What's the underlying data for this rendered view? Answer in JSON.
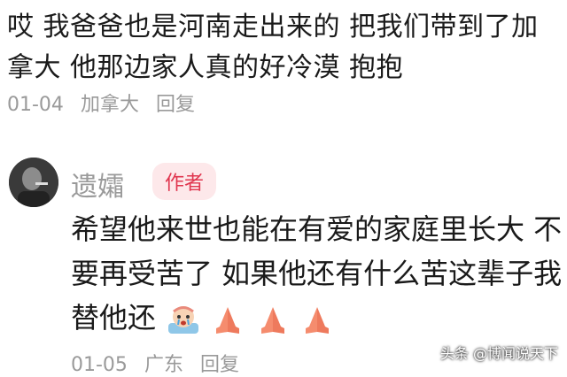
{
  "comment1": {
    "text": "哎 我爸爸也是河南走出来的 把我们带到了加拿大 他那边家人真的好冷漠 抱抱",
    "date": "01-04",
    "location": "加拿大",
    "reply_label": "回复"
  },
  "reply": {
    "username": "遗孀",
    "badge": "作者",
    "text": "希望他来世也能在有爱的家庭里长大 不要再受苦了 如果他还有什么苦这辈子我替他还",
    "emojis": [
      "crying-emoji",
      "pray-hands-icon",
      "pray-hands-icon",
      "pray-hands-icon"
    ],
    "date": "01-05",
    "location": "广东",
    "reply_label": "回复"
  },
  "watermark": {
    "text": "头条 @博闻说天下"
  },
  "colors": {
    "badge_bg": "#fde8ea",
    "badge_text": "#e0364f",
    "meta_text": "#9a9a9a"
  }
}
